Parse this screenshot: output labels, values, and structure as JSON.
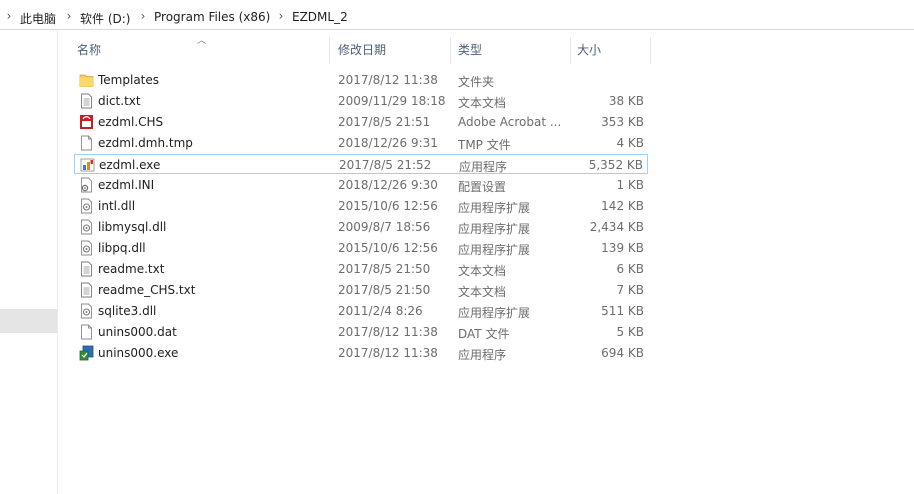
{
  "breadcrumb": [
    "此电脑",
    "软件 (D:)",
    "Program Files (x86)",
    "EZDML_2"
  ],
  "columns": {
    "name": "名称",
    "date": "修改日期",
    "type": "类型",
    "size": "大小"
  },
  "files": [
    {
      "name": "Templates",
      "date": "2017/8/12 11:38",
      "type": "文件夹",
      "size": "",
      "icon": "folder-icon"
    },
    {
      "name": "dict.txt",
      "date": "2009/11/29 18:18",
      "type": "文本文档",
      "size": "38 KB",
      "icon": "text-file-icon"
    },
    {
      "name": "ezdml.CHS",
      "date": "2017/8/5 21:51",
      "type": "Adobe Acrobat ...",
      "size": "353 KB",
      "icon": "acrobat-file-icon"
    },
    {
      "name": "ezdml.dmh.tmp",
      "date": "2018/12/26 9:31",
      "type": "TMP 文件",
      "size": "4 KB",
      "icon": "blank-file-icon"
    },
    {
      "name": "ezdml.exe",
      "date": "2017/8/5 21:52",
      "type": "应用程序",
      "size": "5,352 KB",
      "icon": "ezdml-app-icon"
    },
    {
      "name": "ezdml.INI",
      "date": "2018/12/26 9:30",
      "type": "配置设置",
      "size": "1 KB",
      "icon": "settings-file-icon"
    },
    {
      "name": "intl.dll",
      "date": "2015/10/6 12:56",
      "type": "应用程序扩展",
      "size": "142 KB",
      "icon": "dll-file-icon"
    },
    {
      "name": "libmysql.dll",
      "date": "2009/8/7 18:56",
      "type": "应用程序扩展",
      "size": "2,434 KB",
      "icon": "dll-file-icon"
    },
    {
      "name": "libpq.dll",
      "date": "2015/10/6 12:56",
      "type": "应用程序扩展",
      "size": "139 KB",
      "icon": "dll-file-icon"
    },
    {
      "name": "readme.txt",
      "date": "2017/8/5 21:50",
      "type": "文本文档",
      "size": "6 KB",
      "icon": "text-file-icon"
    },
    {
      "name": "readme_CHS.txt",
      "date": "2017/8/5 21:50",
      "type": "文本文档",
      "size": "7 KB",
      "icon": "text-file-icon"
    },
    {
      "name": "sqlite3.dll",
      "date": "2011/2/4 8:26",
      "type": "应用程序扩展",
      "size": "511 KB",
      "icon": "dll-file-icon"
    },
    {
      "name": "unins000.dat",
      "date": "2017/8/12 11:38",
      "type": "DAT 文件",
      "size": "5 KB",
      "icon": "blank-file-icon"
    },
    {
      "name": "unins000.exe",
      "date": "2017/8/12 11:38",
      "type": "应用程序",
      "size": "694 KB",
      "icon": "installer-app-icon"
    }
  ],
  "selected_index": 4,
  "colors": {
    "header_text": "#4c607a",
    "selection_border": "#99d1ff",
    "detail_text": "#6d6d6d",
    "folder": "#f5c85a"
  }
}
